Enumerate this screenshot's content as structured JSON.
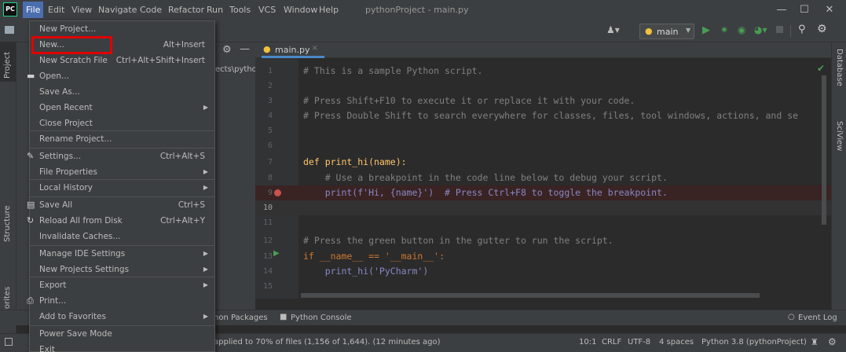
{
  "app": {
    "logo": "PC",
    "window_title": "pythonProject - main.py"
  },
  "menubar": [
    "File",
    "Edit",
    "View",
    "Navigate",
    "Code",
    "Refactor",
    "Run",
    "Tools",
    "VCS",
    "Window",
    "Help"
  ],
  "navbar": {
    "branch": "main",
    "run_config": ""
  },
  "tab": {
    "name": "main.py"
  },
  "project_panel": {
    "label": "Project",
    "path_fragment": "ects\\pytho"
  },
  "left_tools": [
    "Project",
    "Structure",
    "Favorites"
  ],
  "right_tools": [
    "Database",
    "SciView"
  ],
  "code": {
    "lines": [
      {
        "n": "1",
        "text": "# This is a sample Python script."
      },
      {
        "n": "2",
        "text": ""
      },
      {
        "n": "3",
        "text": "# Press Shift+F10 to execute it or replace it with your code."
      },
      {
        "n": "4",
        "text": "# Press Double Shift to search everywhere for classes, files, tool windows, actions, and se"
      },
      {
        "n": "5",
        "text": ""
      },
      {
        "n": "6",
        "text": ""
      },
      {
        "n": "7",
        "text": "def print_hi(name):"
      },
      {
        "n": "8",
        "text": "    # Use a breakpoint in the code line below to debug your script."
      },
      {
        "n": "9",
        "text": "    print(f'Hi, {name}')  # Press Ctrl+F8 to toggle the breakpoint."
      },
      {
        "n": "10",
        "text": ""
      },
      {
        "n": "11",
        "text": ""
      },
      {
        "n": "12",
        "text": "# Press the green button in the gutter to run the script."
      },
      {
        "n": "13",
        "text": "if __name__ == '__main__':"
      },
      {
        "n": "14",
        "text": "    print_hi('PyCharm')"
      },
      {
        "n": "15",
        "text": ""
      }
    ]
  },
  "file_menu": {
    "items": [
      {
        "label": "New Project...",
        "shortcut": "",
        "arrow": false,
        "icon": ""
      },
      {
        "label": "New...",
        "shortcut": "Alt+Insert",
        "arrow": false,
        "icon": ""
      },
      {
        "label": "New Scratch File",
        "shortcut": "Ctrl+Alt+Shift+Insert",
        "arrow": false,
        "icon": ""
      },
      {
        "label": "Open...",
        "shortcut": "",
        "arrow": false,
        "icon": "folder-icon"
      },
      {
        "label": "Save As...",
        "shortcut": "",
        "arrow": false,
        "icon": ""
      },
      {
        "label": "Open Recent",
        "shortcut": "",
        "arrow": true,
        "icon": ""
      },
      {
        "label": "Close Project",
        "shortcut": "",
        "arrow": false,
        "icon": ""
      },
      {
        "label": "Rename Project...",
        "shortcut": "",
        "arrow": false,
        "icon": ""
      },
      {
        "label": "Settings...",
        "shortcut": "Ctrl+Alt+S",
        "arrow": false,
        "icon": "wrench-icon"
      },
      {
        "label": "File Properties",
        "shortcut": "",
        "arrow": true,
        "icon": ""
      },
      {
        "label": "Local History",
        "shortcut": "",
        "arrow": true,
        "icon": ""
      },
      {
        "label": "Save All",
        "shortcut": "Ctrl+S",
        "arrow": false,
        "icon": "save-icon"
      },
      {
        "label": "Reload All from Disk",
        "shortcut": "Ctrl+Alt+Y",
        "arrow": false,
        "icon": "reload-icon"
      },
      {
        "label": "Invalidate Caches...",
        "shortcut": "",
        "arrow": false,
        "icon": ""
      },
      {
        "label": "Manage IDE Settings",
        "shortcut": "",
        "arrow": true,
        "icon": ""
      },
      {
        "label": "New Projects Settings",
        "shortcut": "",
        "arrow": true,
        "icon": ""
      },
      {
        "label": "Export",
        "shortcut": "",
        "arrow": true,
        "icon": ""
      },
      {
        "label": "Print...",
        "shortcut": "",
        "arrow": false,
        "icon": "print-icon"
      },
      {
        "label": "Add to Favorites",
        "shortcut": "",
        "arrow": true,
        "icon": ""
      },
      {
        "label": "Power Save Mode",
        "shortcut": "",
        "arrow": false,
        "icon": ""
      },
      {
        "label": "Exit",
        "shortcut": "",
        "arrow": false,
        "icon": ""
      }
    ]
  },
  "bottom_tabs": {
    "packages": "hon Packages",
    "console": "Python Console",
    "event_log": "Event Log"
  },
  "status": {
    "message": "applied to 70% of files (1,156 of 1,644). (12 minutes ago)",
    "position": "10:1",
    "line_sep": "CRLF",
    "encoding": "UTF-8",
    "indent": "4 spaces",
    "interpreter": "Python 3.8 (pythonProject)"
  },
  "colors": {
    "accent": "#4b6eaf",
    "highlight_box": "#e00000",
    "breakpoint": "#c75450",
    "run_green": "#499c54"
  }
}
